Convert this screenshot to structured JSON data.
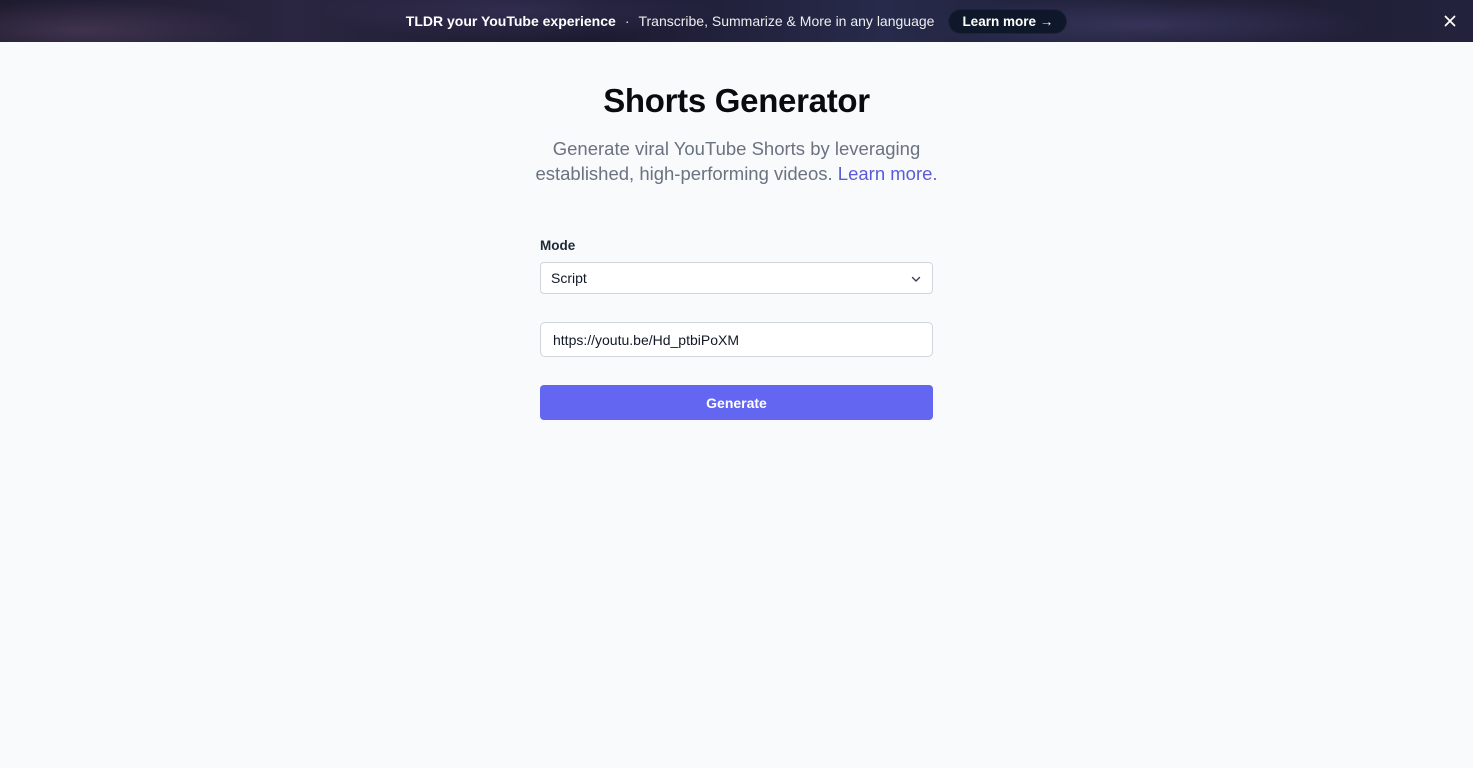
{
  "banner": {
    "title": "TLDR your YouTube experience",
    "separator": "·",
    "subtitle": "Transcribe, Summarize & More in any language",
    "cta_label": "Learn more →",
    "close_icon": "close-icon"
  },
  "page": {
    "title": "Shorts Generator",
    "subtitle": "Generate viral YouTube Shorts by leveraging established, high-performing videos.",
    "learn_more": "Learn more."
  },
  "form": {
    "mode_label": "Mode",
    "mode_selected": "Script",
    "chevron_icon": "chevron-down-icon",
    "url_value": "https://youtu.be/Hd_ptbiPoXM",
    "generate_label": "Generate"
  },
  "colors": {
    "accent": "#6366f1",
    "link": "#5b5bd6",
    "background": "#f8fafc",
    "banner_button": "#0f172a"
  }
}
